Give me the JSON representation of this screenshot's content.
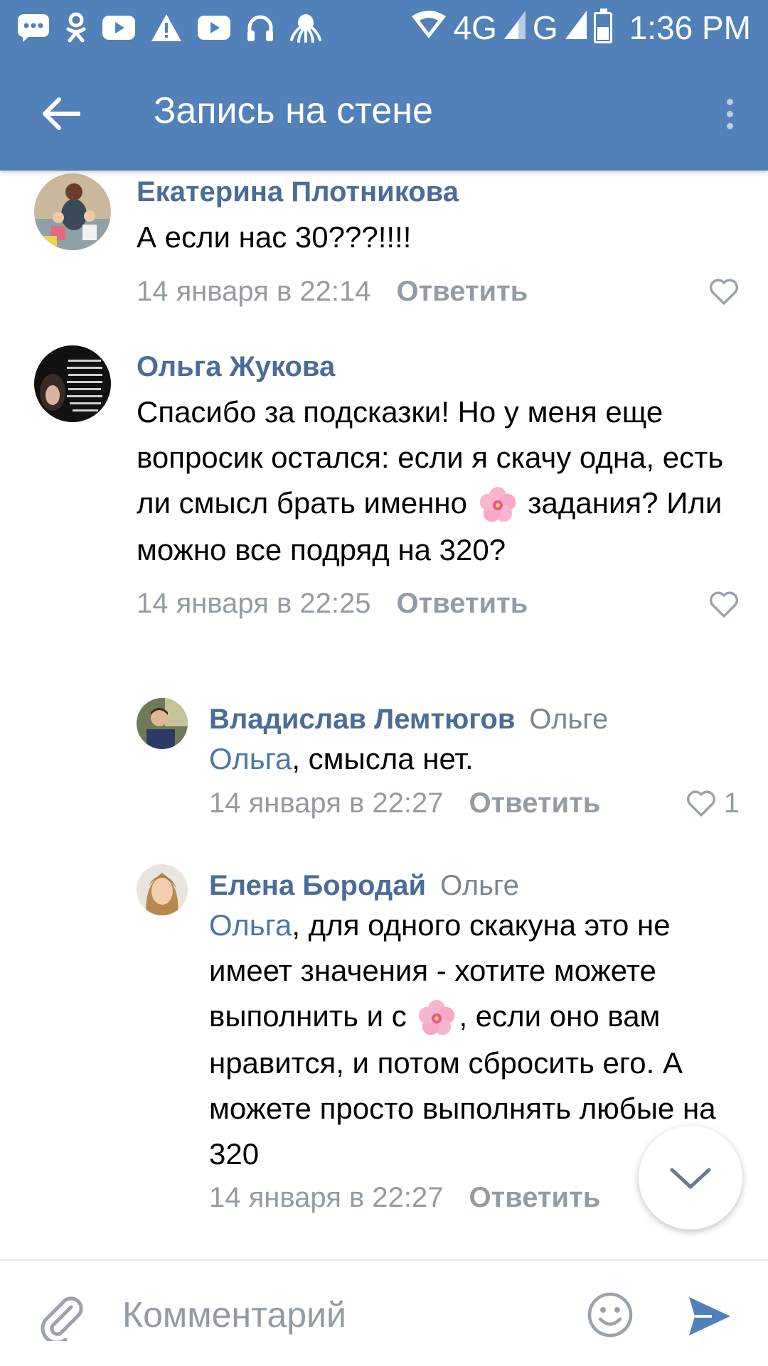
{
  "status_bar": {
    "network_1": "4G",
    "network_2": "G",
    "time": "1:36 PM",
    "icons": [
      "chat-icon",
      "odnoklassniki-icon",
      "youtube-icon",
      "warning-icon",
      "youtube-icon",
      "headphones-icon",
      "octopus-icon",
      "wifi-icon",
      "signal-icon",
      "battery-icon"
    ]
  },
  "toolbar": {
    "title": "Запись на стене",
    "back_icon": "back-arrow-icon",
    "menu_icon": "more-vert-icon"
  },
  "comments": [
    {
      "author": "Екатерина Плотникова",
      "text": "А если нас 30???!!!!",
      "date": "14 января в 22:14",
      "reply_label": "Ответить",
      "likes": ""
    },
    {
      "author": "Ольга Жукова",
      "text_parts": [
        "Спасибо за подсказки! Но у меня еще вопросик остался: если я скачу одна, есть ли смысл брать именно",
        "задания? Или можно все подряд на 320?"
      ],
      "date": "14 января в 22:25",
      "reply_label": "Ответить",
      "likes": ""
    },
    {
      "author": "Владислав Лемтюгов",
      "reply_to": "Ольге",
      "mention": "Ольга",
      "text": ", смысла нет.",
      "date": "14 января в 22:27",
      "reply_label": "Ответить",
      "likes": "1"
    },
    {
      "author": "Елена Бородай",
      "reply_to": "Ольге",
      "mention": "Ольга",
      "text_parts": [
        ", для одного скакуна это не имеет значения - хотите можете выполнить и с",
        ", если оно вам нравится, и потом сбросить его. А можете просто выполнять любые на 320"
      ],
      "date": "14 января в 22:27",
      "reply_label": "Ответить",
      "likes": ""
    }
  ],
  "composer": {
    "placeholder": "Комментарий",
    "attach_icon": "paperclip-icon",
    "emoji_icon": "smiley-icon",
    "send_icon": "send-icon"
  },
  "colors": {
    "header": "#5181b8",
    "author": "#4a6c98",
    "mention": "#4a76a8",
    "meta": "#939ba4",
    "send": "#5181b8"
  }
}
